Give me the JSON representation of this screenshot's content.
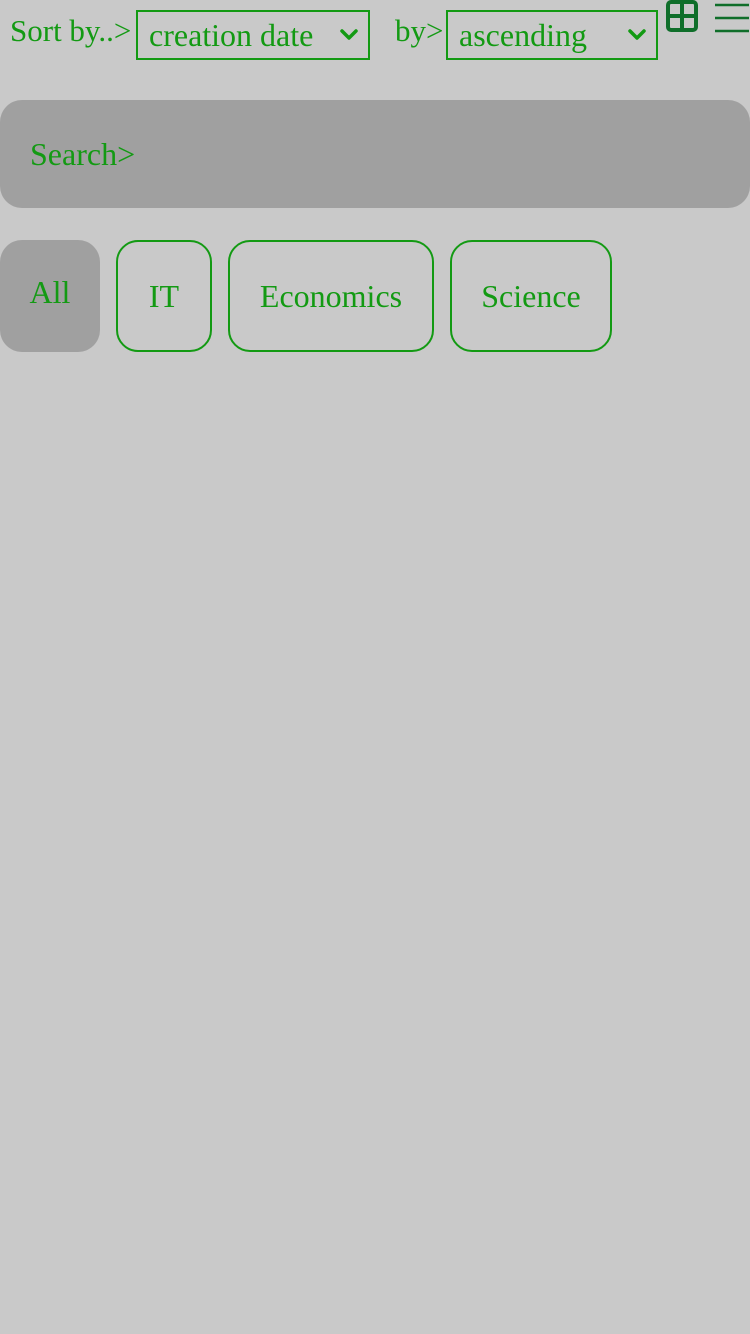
{
  "toolbar": {
    "sort_label": "Sort by..>",
    "sort_field": "creation date",
    "order_label": "by>",
    "order_value": "ascending",
    "grid_icon": "grid-view-icon",
    "menu_icon": "hamburger-menu-icon"
  },
  "search": {
    "placeholder": "Search>"
  },
  "categories": [
    {
      "label": "All",
      "active": true
    },
    {
      "label": "IT",
      "active": false
    },
    {
      "label": "Economics",
      "active": false
    },
    {
      "label": "Science",
      "active": false
    }
  ],
  "colors": {
    "accent": "#139a13",
    "icon": "#0f6e2a",
    "background": "#c9c9c9",
    "fill": "#a0a0a0"
  }
}
